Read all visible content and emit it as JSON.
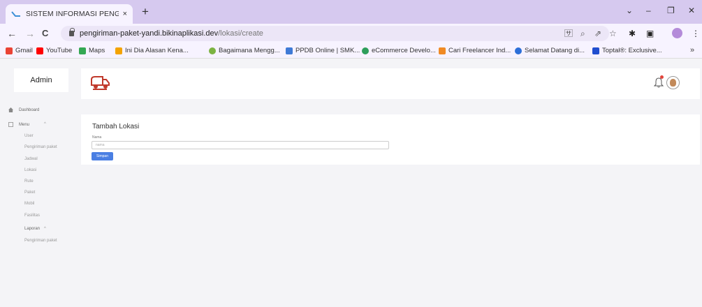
{
  "browser": {
    "tab": {
      "title": "SISTEM INFORMASI PENGIRIMAN",
      "close": "×"
    },
    "new_tab": "+",
    "window_controls": {
      "minimize": "–",
      "restore": "❐",
      "close": "✕",
      "tab_search": "⌄"
    },
    "nav": {
      "back": "←",
      "forward": "→",
      "reload": "C"
    },
    "address": {
      "host": "pengiriman-paket-yandi.bikinaplikasi.dev",
      "path": "/lokasi/create"
    },
    "toolbar_icons": {
      "translate": "🈂",
      "zoom": "⌕",
      "share": "⇗",
      "bookmark": "☆",
      "extensions": "✱",
      "sidebar": "▣",
      "menu": "⋮"
    },
    "bookmarks": [
      {
        "label": "Gmail",
        "icon": "gmail-icon",
        "color": "#ea4335"
      },
      {
        "label": "YouTube",
        "icon": "youtube-icon",
        "color": "#ff0000"
      },
      {
        "label": "Maps",
        "icon": "maps-icon",
        "color": "#34a853"
      },
      {
        "label": "Ini Dia Alasan Kena...",
        "icon": "pinwheel-icon",
        "color": "#f4a300"
      },
      {
        "label": "Bagaimana Mengg...",
        "icon": "leaf-icon",
        "color": "#7cb342"
      },
      {
        "label": "PPDB Online | SMK...",
        "icon": "ppdb-icon",
        "color": "#3f7ad6"
      },
      {
        "label": "eCommerce Develo...",
        "icon": "ecommerce-icon",
        "color": "#2e9e5b"
      },
      {
        "label": "Cari Freelancer Ind...",
        "icon": "freelancer-icon",
        "color": "#f08a24"
      },
      {
        "label": "Selamat Datang di...",
        "icon": "globe-icon",
        "color": "#2d6fd8"
      },
      {
        "label": "Toptal®: Exclusive...",
        "icon": "toptal-icon",
        "color": "#204ecf"
      }
    ],
    "bookmarks_more": "»"
  },
  "app": {
    "brand": "Admin",
    "sidebar": {
      "dashboard": "Dashboard",
      "menu_title": "Menu",
      "menu_items": [
        "User",
        "Pengiriman paket",
        "Jadwal",
        "Lokasi",
        "Rute",
        "Paket",
        "Mobil",
        "Fasilitas"
      ],
      "report_title": "Laporan",
      "report_items": [
        "Pengiriman paket"
      ],
      "chevron": "^"
    },
    "form": {
      "title": "Tambah Lokasi",
      "name_label": "Nama",
      "name_placeholder": "nama",
      "name_value": "",
      "submit_label": "Simpan"
    },
    "colors": {
      "accent": "#4a7fe3",
      "logo": "#c0392b",
      "notification": "#e2453c"
    }
  }
}
